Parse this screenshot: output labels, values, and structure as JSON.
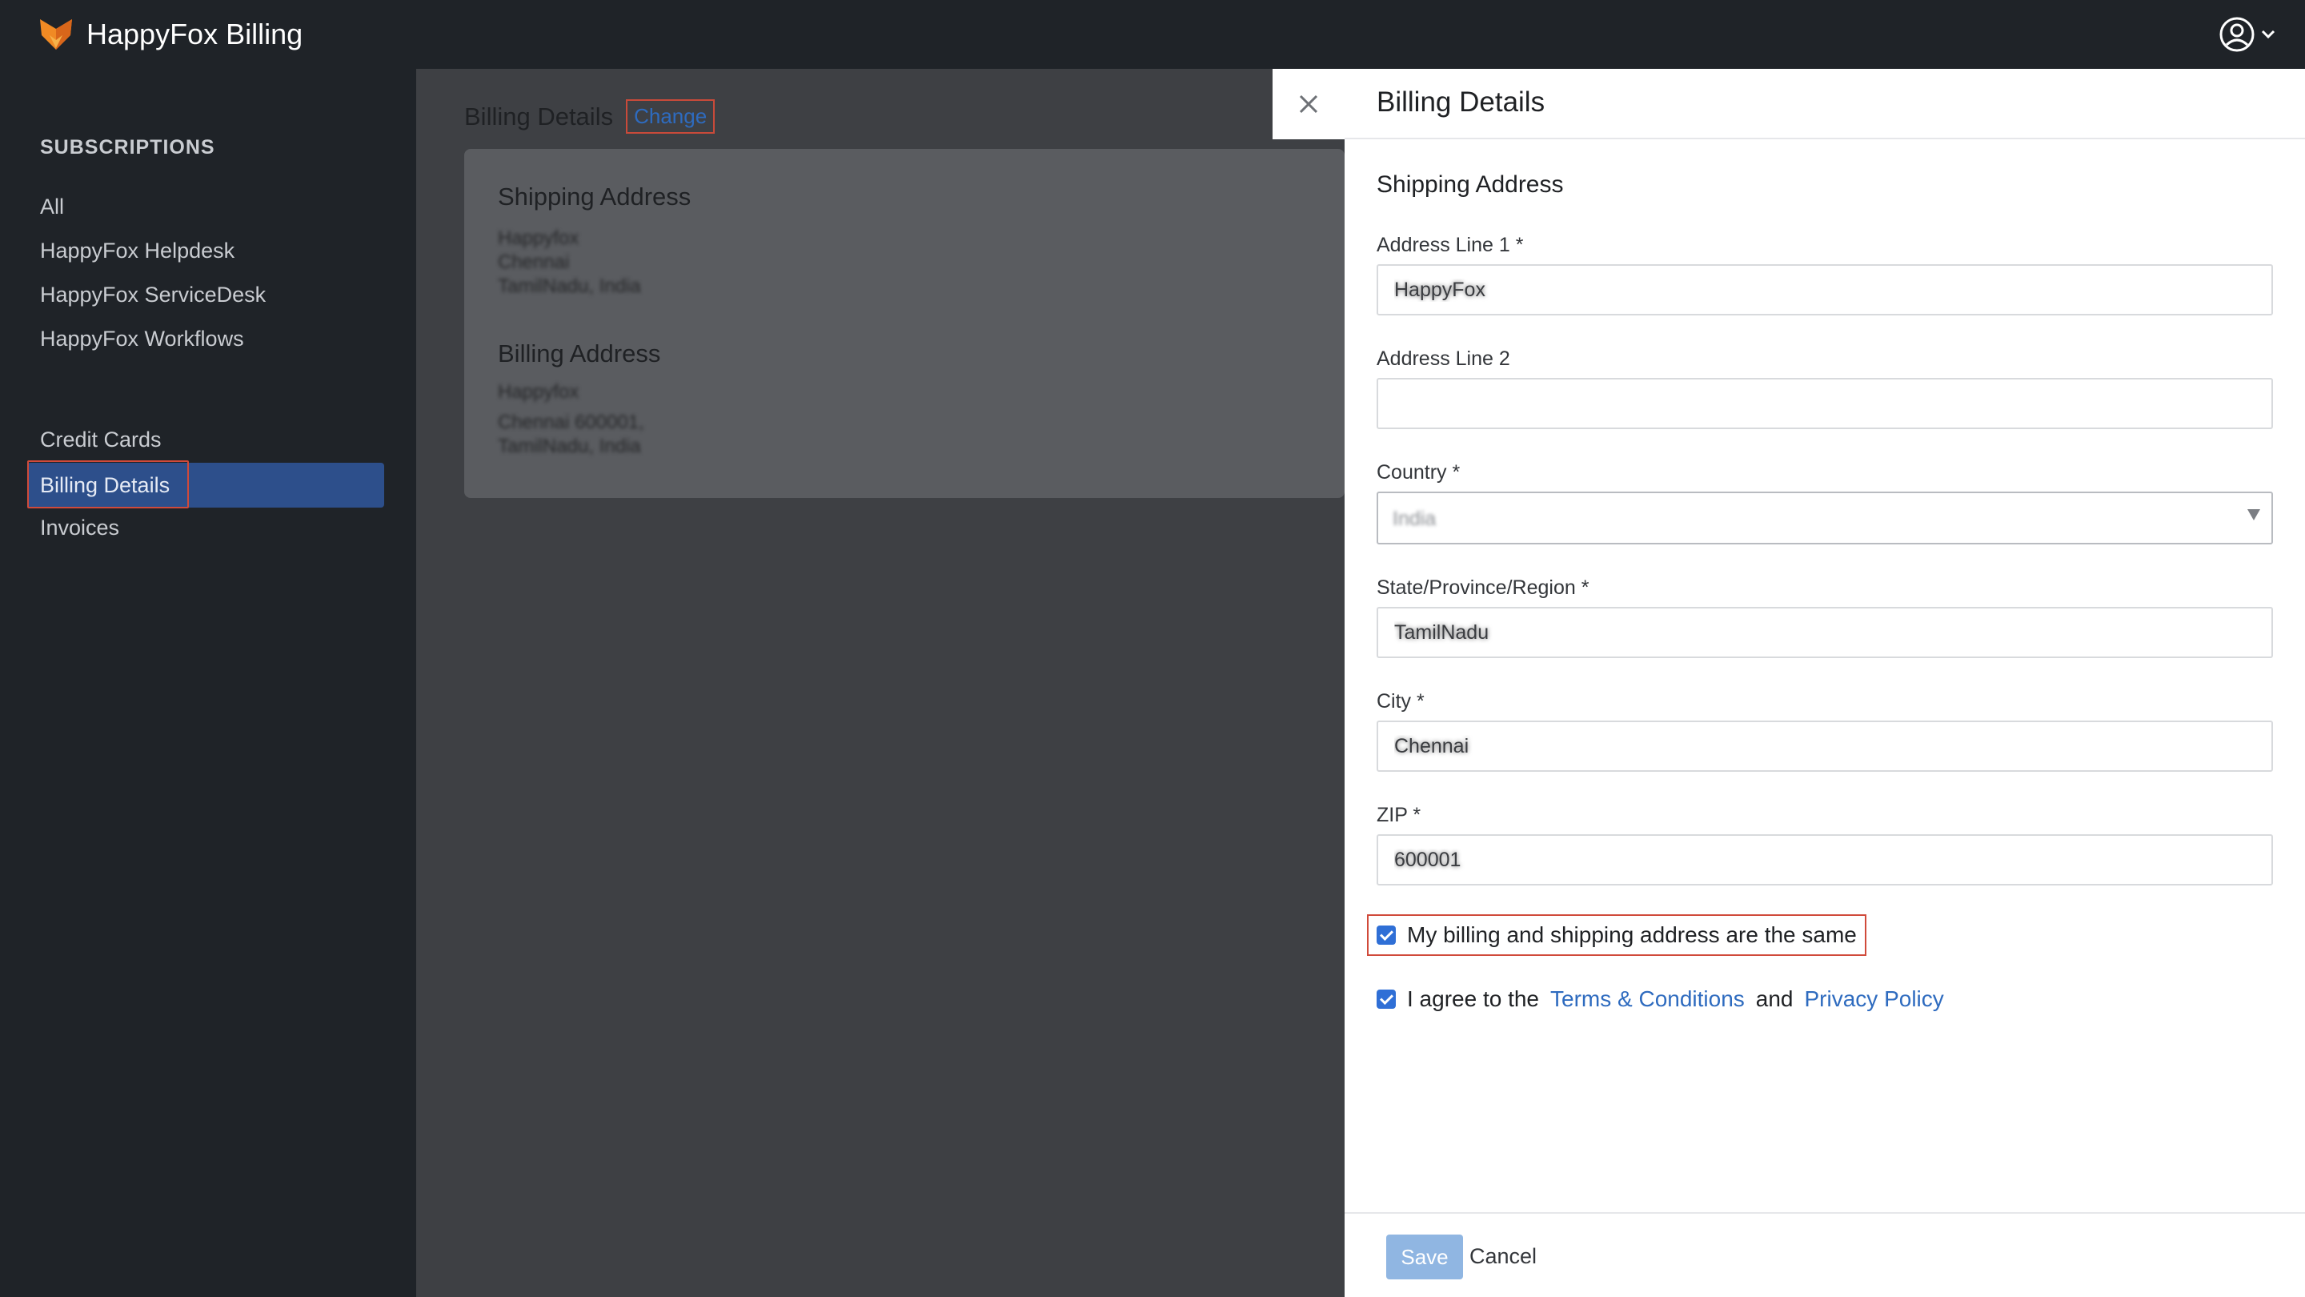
{
  "app": {
    "title": "HappyFox Billing",
    "logo_icon": "happyfox-fox-logo",
    "user_icon": "user-circle-icon",
    "colors": {
      "topbar": "#1f2328",
      "accent": "#2e6bbf",
      "active_item": "#2d4f8b",
      "highlight_outline": "#d04a3a"
    }
  },
  "sidebar": {
    "heading": "SUBSCRIPTIONS",
    "subscriptions": [
      {
        "label": "All"
      },
      {
        "label": "HappyFox Helpdesk"
      },
      {
        "label": "HappyFox ServiceDesk"
      },
      {
        "label": "HappyFox Workflows"
      }
    ],
    "account": [
      {
        "label": "Credit Cards"
      },
      {
        "label": "Billing Details",
        "active": true
      },
      {
        "label": "Invoices"
      }
    ]
  },
  "main": {
    "title": "Billing Details",
    "change_link": "Change",
    "shipping_heading": "Shipping Address",
    "shipping_lines": [
      "Happyfox",
      "Chennai",
      "TamilNadu, India"
    ],
    "billing_heading": "Billing Address",
    "billing_lines": [
      "Happyfox",
      "Chennai 600001,",
      "TamilNadu, India"
    ]
  },
  "drawer": {
    "title": "Billing Details",
    "close_icon": "close-icon",
    "section_title": "Shipping Address",
    "fields": {
      "address1": {
        "label": "Address Line 1 *",
        "value": "HappyFox"
      },
      "address2": {
        "label": "Address Line 2",
        "value": ""
      },
      "country": {
        "label": "Country *",
        "value": "India"
      },
      "state": {
        "label": "State/Province/Region *",
        "value": "TamilNadu"
      },
      "city": {
        "label": "City *",
        "value": "Chennai"
      },
      "zip": {
        "label": "ZIP *",
        "value": "600001"
      }
    },
    "same_address": {
      "label": "My billing and shipping address are the same",
      "checked": true
    },
    "agree": {
      "prefix": "I agree to the",
      "terms": "Terms & Conditions",
      "middle": "and",
      "privacy": "Privacy Policy",
      "checked": true
    },
    "save_label": "Save",
    "cancel_label": "Cancel"
  }
}
